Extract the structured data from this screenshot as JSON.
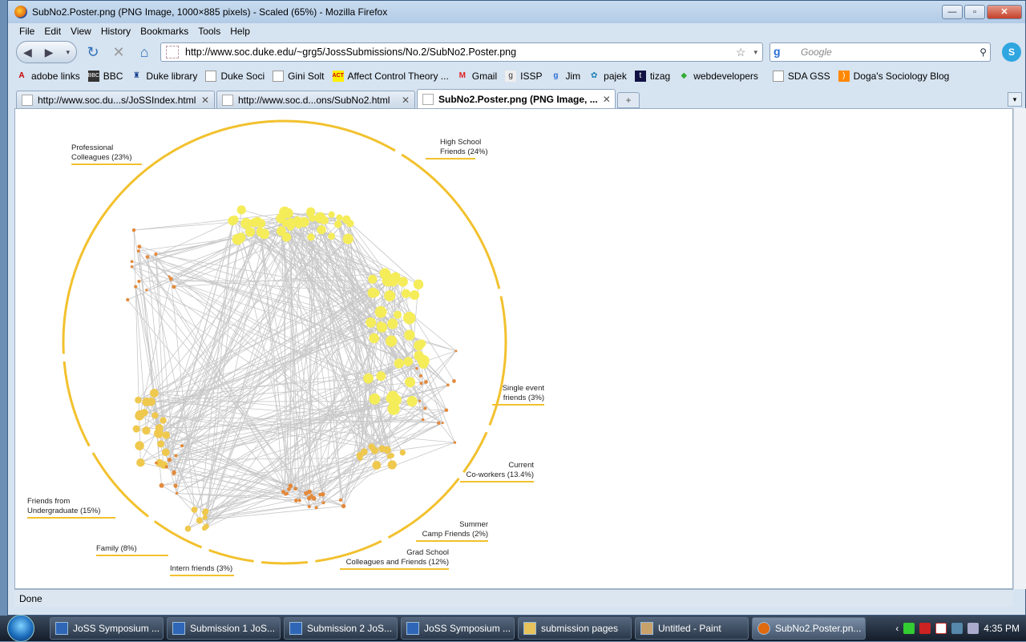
{
  "window": {
    "title": "SubNo2.Poster.png (PNG Image, 1000×885 pixels) - Scaled (65%) - Mozilla Firefox",
    "buttons": {
      "minimize": "—",
      "maximize": "▫",
      "close": "✕"
    }
  },
  "menu": [
    "File",
    "Edit",
    "View",
    "History",
    "Bookmarks",
    "Tools",
    "Help"
  ],
  "nav": {
    "url": "http://www.soc.duke.edu/~grg5/JossSubmissions/No.2/SubNo2.Poster.png",
    "search_placeholder": "Google"
  },
  "bookmarks": [
    {
      "label": "adobe links",
      "icon": "adobe-icon"
    },
    {
      "label": "BBC",
      "icon": "bbc-icon"
    },
    {
      "label": "Duke library",
      "icon": "duke-icon"
    },
    {
      "label": "Duke Soci",
      "icon": "page-icon"
    },
    {
      "label": "Gini Solt",
      "icon": "page-icon"
    },
    {
      "label": "Affect Control Theory ...",
      "icon": "act-icon"
    },
    {
      "label": "Gmail",
      "icon": "gmail-icon"
    },
    {
      "label": "ISSP",
      "icon": "issp-icon"
    },
    {
      "label": "Jim",
      "icon": "google-icon"
    },
    {
      "label": "pajek",
      "icon": "pajek-icon"
    },
    {
      "label": "tizag",
      "icon": "tizag-icon"
    },
    {
      "label": "webdevelopers",
      "icon": "web-icon"
    },
    {
      "label": "SDA GSS",
      "icon": "page-icon"
    },
    {
      "label": "Doga's Sociology Blog",
      "icon": "rss-icon"
    }
  ],
  "tabs": [
    {
      "label": "http://www.soc.du...s/JoSSIndex.html"
    },
    {
      "label": "http://www.soc.d...ons/SubNo2.html"
    },
    {
      "label": "SubNo2.Poster.png (PNG Image, ..."
    }
  ],
  "poster": {
    "labels": {
      "professional": [
        "Professional",
        "Colleagues (23%)"
      ],
      "highschool": [
        "High School",
        "Friends (24%)"
      ],
      "single": [
        "Single event",
        "friends (3%)"
      ],
      "coworkers": [
        "Current",
        "Co-workers (13.4%)"
      ],
      "summer": [
        "Summer",
        "Camp Friends (2%)"
      ],
      "grad": [
        "Grad School",
        "Colleagues and Friends (12%)"
      ],
      "intern": [
        "Intern friends (3%)"
      ],
      "family": [
        "Family (8%)"
      ],
      "undergrad": [
        "Friends from",
        "Undergraduate (15%)"
      ]
    },
    "colors": {
      "ring": "#f2c12e",
      "edge": "#c8c8c8",
      "big_node": "#f5ec5a",
      "mid_node": "#efc84e",
      "small_node": "#e38a3c"
    }
  },
  "status": "Done",
  "taskbar": {
    "items": [
      {
        "label": "JoSS Symposium ..."
      },
      {
        "label": "Submission 1 JoS..."
      },
      {
        "label": "Submission 2 JoS..."
      },
      {
        "label": "JoSS Symposium ..."
      },
      {
        "label": "submission pages"
      },
      {
        "label": "Untitled - Paint"
      },
      {
        "label": "SubNo2.Poster.pn..."
      }
    ],
    "clock": "4:35 PM"
  }
}
